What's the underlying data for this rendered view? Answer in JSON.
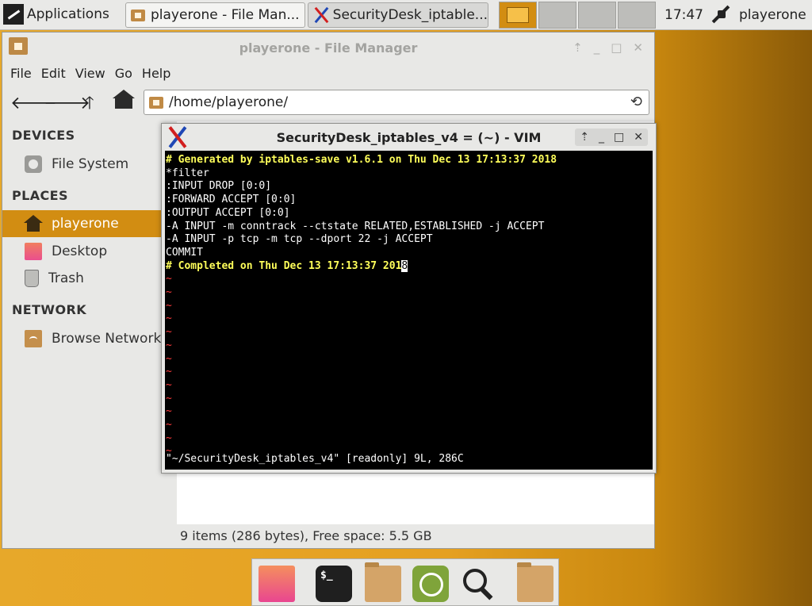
{
  "panel": {
    "applications_label": "Applications",
    "tasks": [
      {
        "label": "playerone - File Man...",
        "icon": "folder-icon"
      },
      {
        "label": "SecurityDesk_iptable...",
        "icon": "vim-x-icon"
      }
    ],
    "clock": "17:47",
    "user": "playerone"
  },
  "file_manager": {
    "title": "playerone - File Manager",
    "menu": [
      "File",
      "Edit",
      "View",
      "Go",
      "Help"
    ],
    "path": "/home/playerone/",
    "sidebar": {
      "devices_heading": "DEVICES",
      "devices": [
        {
          "label": "File System",
          "icon": "disk-icon"
        }
      ],
      "places_heading": "PLACES",
      "places": [
        {
          "label": "playerone",
          "icon": "home-icon",
          "selected": true
        },
        {
          "label": "Desktop",
          "icon": "desktop-icon"
        },
        {
          "label": "Trash",
          "icon": "trash-icon"
        }
      ],
      "network_heading": "NETWORK",
      "network": [
        {
          "label": "Browse Network",
          "icon": "network-folder-icon"
        }
      ]
    },
    "status": "9 items (286 bytes), Free space: 5.5 GB"
  },
  "vim": {
    "title": "SecurityDesk_iptables_v4 = (~) - VIM",
    "lines": [
      "# Generated by iptables-save v1.6.1 on Thu Dec 13 17:13:37 2018",
      "*filter",
      ":INPUT DROP [0:0]",
      ":FORWARD ACCEPT [0:0]",
      ":OUTPUT ACCEPT [0:0]",
      "-A INPUT -m conntrack --ctstate RELATED,ESTABLISHED -j ACCEPT",
      "-A INPUT -p tcp -m tcp --dport 22 -j ACCEPT",
      "COMMIT"
    ],
    "last_line_text": "# Completed on Thu Dec 13 17:13:37 201",
    "last_line_cursor": "8",
    "tilde": "~",
    "status_line": "\"~/SecurityDesk_iptables_v4\" [readonly] 9L, 286C"
  },
  "dock": {
    "terminal_glyph": "$_",
    "items": [
      "desktop-icon",
      "terminal-icon",
      "folder-icon",
      "web-browser-icon",
      "search-icon",
      "folder-icon"
    ]
  },
  "colors": {
    "accent": "#d28d12",
    "comment_yellow": "#ffff5a",
    "tilde_red": "#ff3b3b"
  }
}
